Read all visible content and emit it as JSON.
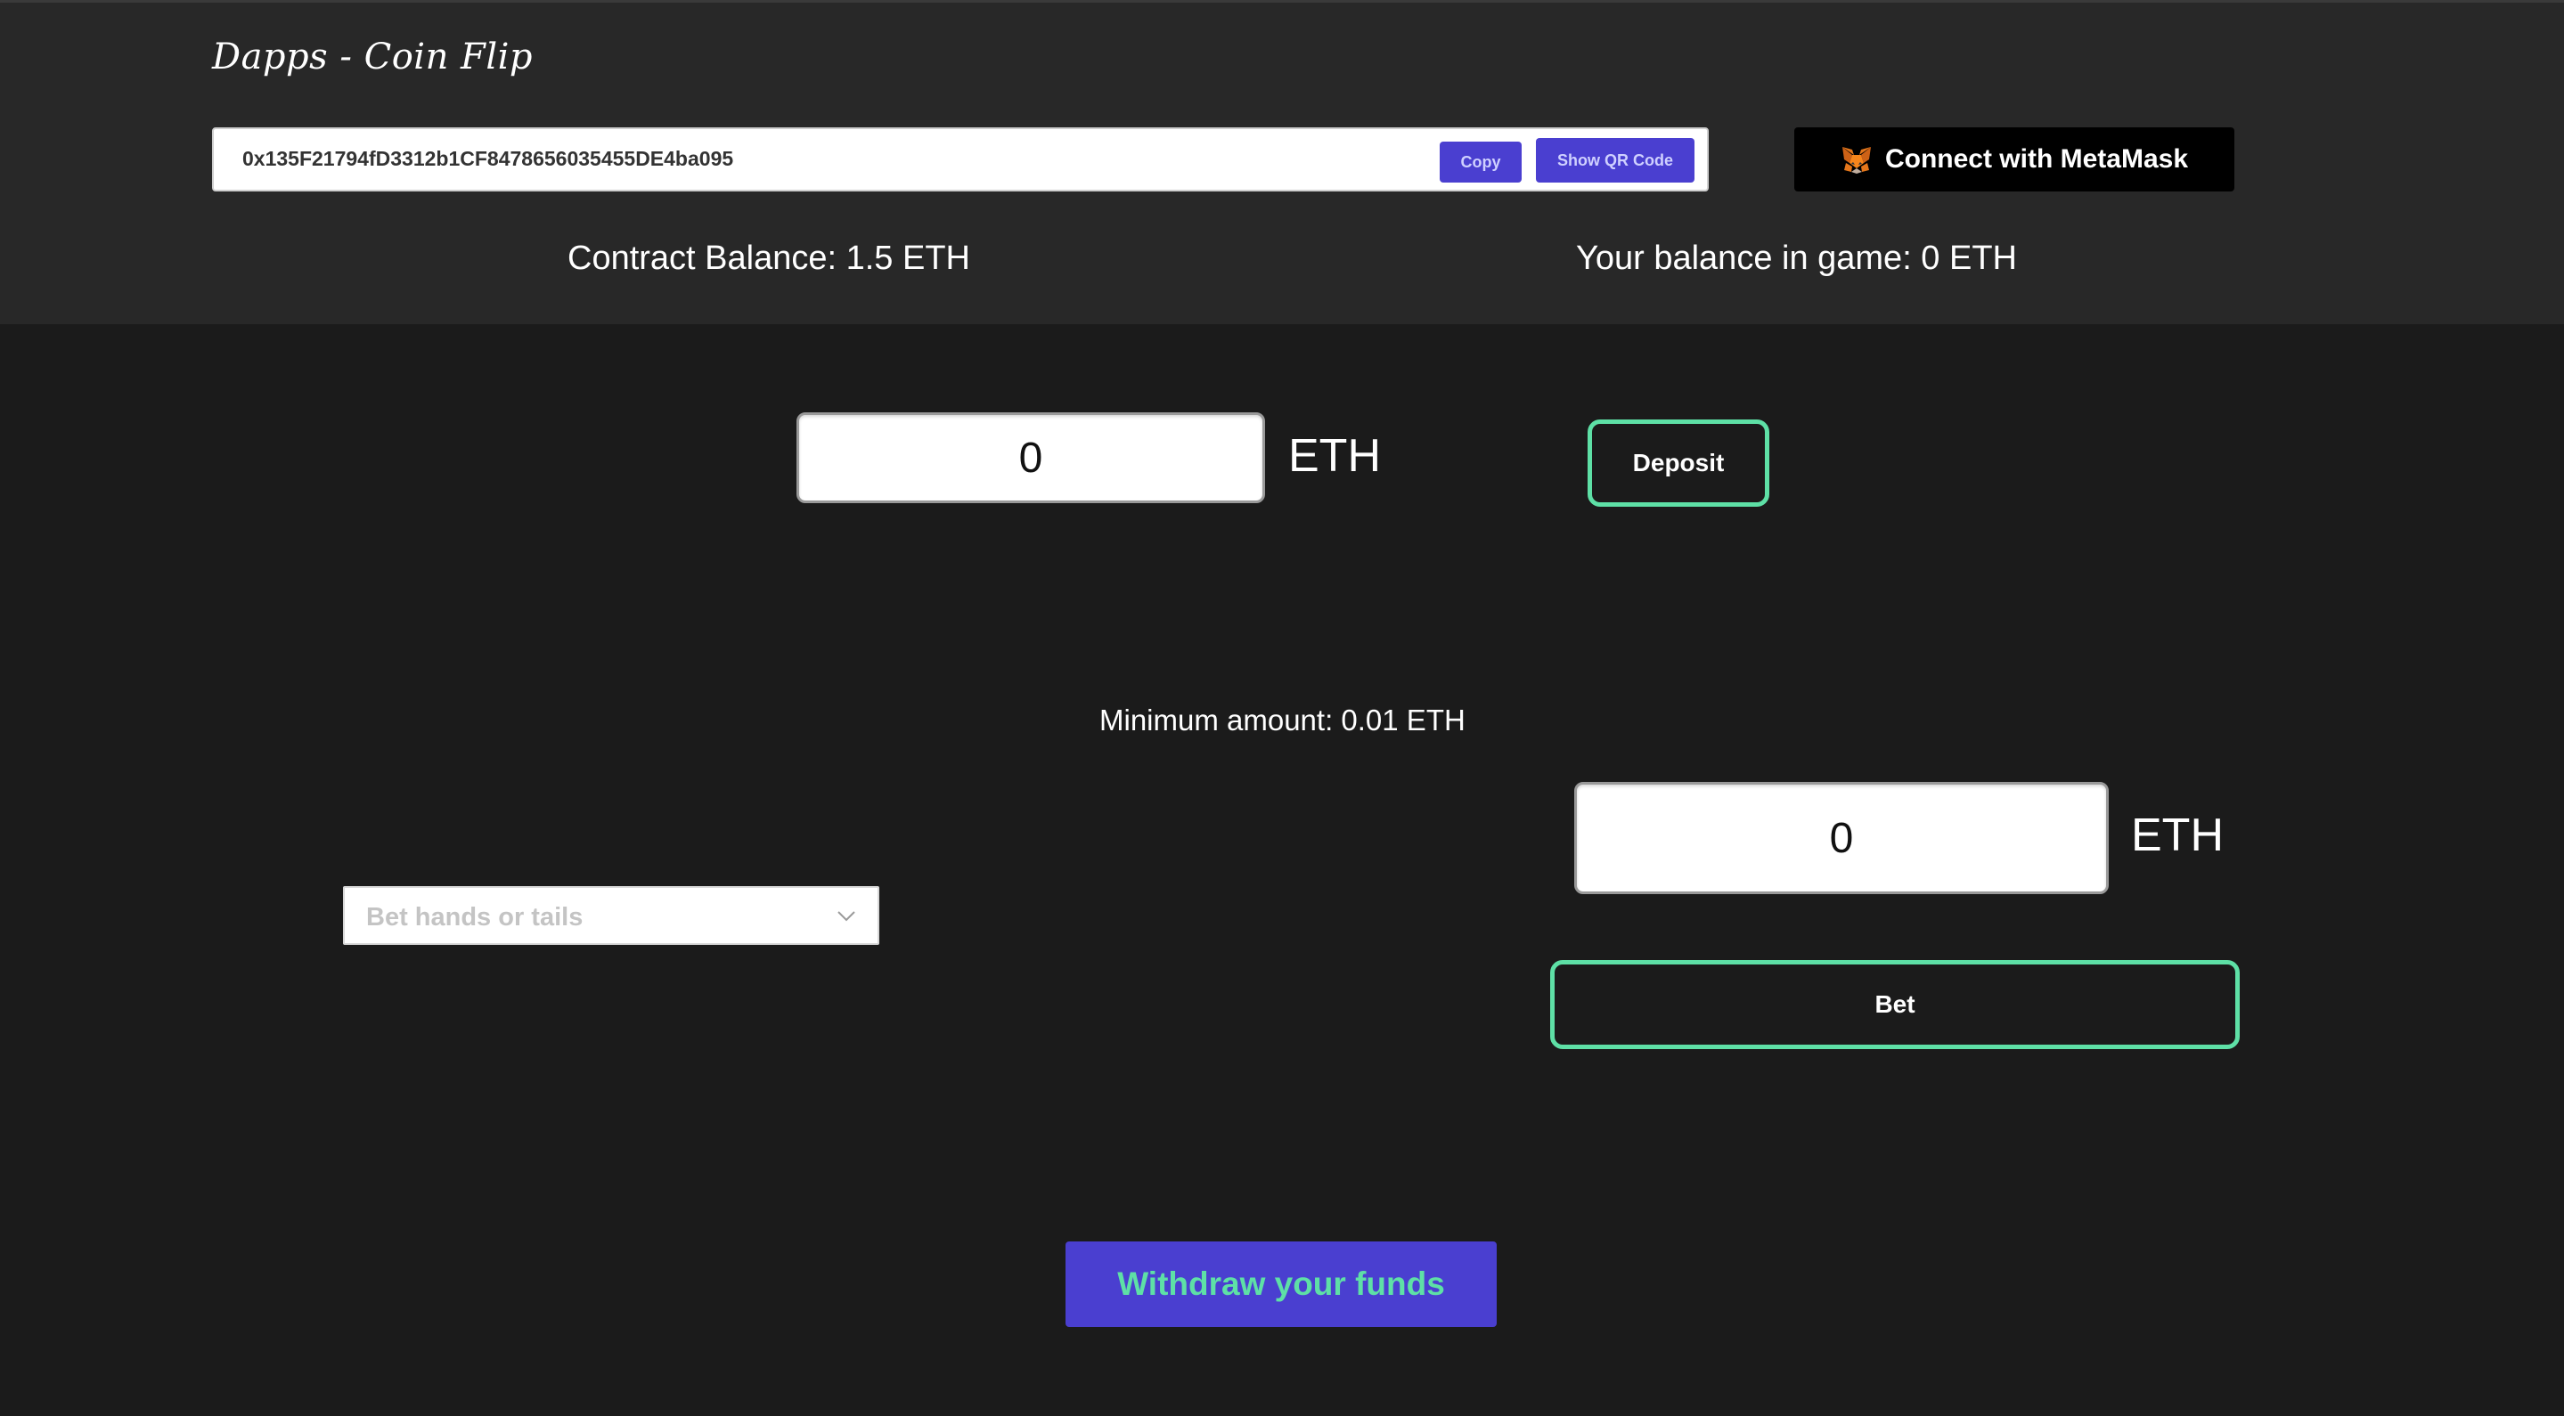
{
  "header": {
    "title": "Dapps - Coin Flip",
    "address": "0x135F21794fD3312b1CF8478656035455DE4ba095",
    "copy_label": "Copy",
    "qr_label": "Show QR Code",
    "metamask_label": "Connect with MetaMask",
    "contract_balance": "Contract Balance: 1.5 ETH",
    "user_balance": "Your balance in game: 0 ETH"
  },
  "deposit": {
    "amount_value": "0",
    "unit": "ETH",
    "button_label": "Deposit"
  },
  "bet": {
    "min_amount": "Minimum amount: 0.01 ETH",
    "select_placeholder": "Bet hands or tails",
    "amount_value": "0",
    "unit": "ETH",
    "button_label": "Bet"
  },
  "withdraw": {
    "button_label": "Withdraw your funds"
  },
  "icons": {
    "metamask": "metamask-fox-icon",
    "select_arrow": "chevron-down-icon"
  },
  "colors": {
    "accent": "#4a3fd0",
    "outline": "#5ee0a6",
    "header_bg": "#282828",
    "page_bg": "#1b1b1b"
  }
}
